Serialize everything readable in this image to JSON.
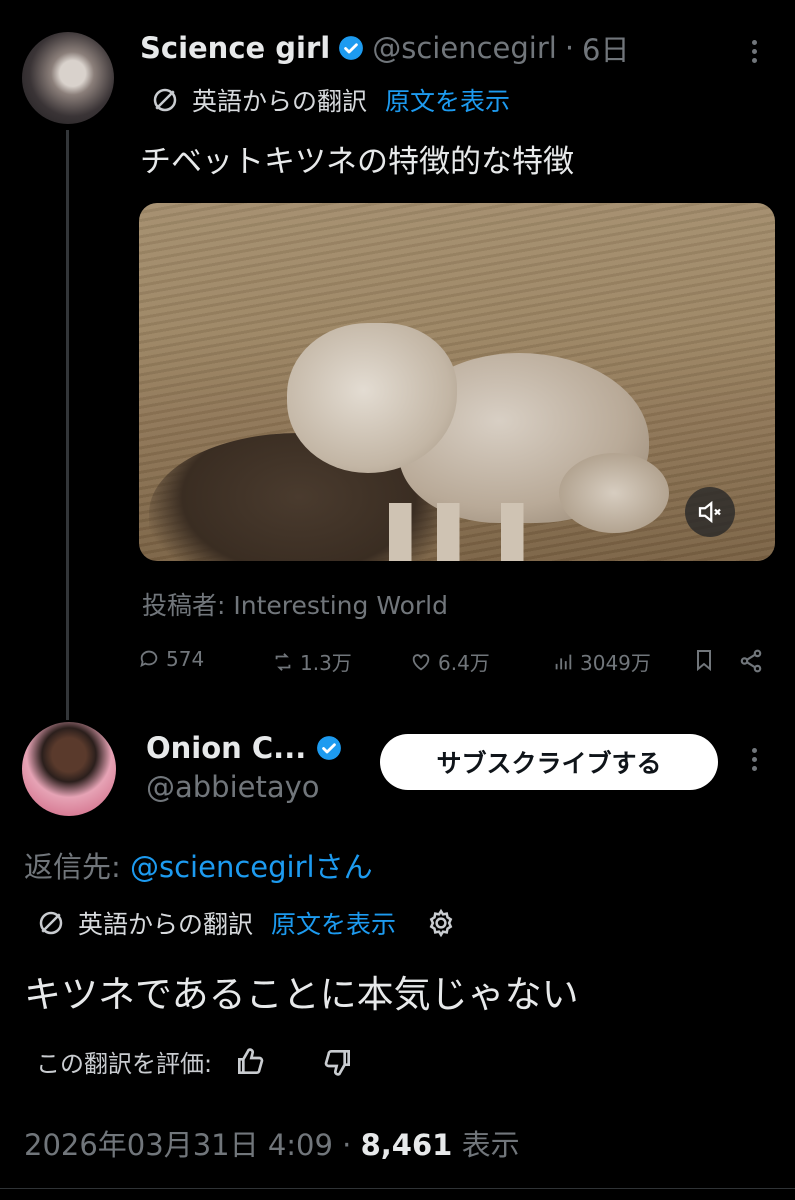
{
  "tweet": {
    "author_name": "Science girl",
    "handle": "@sciencegirl",
    "separator": "·",
    "time": "6日",
    "translated_from": "英語からの翻訳",
    "show_original": "原文を表示",
    "text": "チベットキツネの特徴的な特徴",
    "attribution": "投稿者: Interesting World",
    "actions": {
      "replies": "574",
      "retweets": "1.3万",
      "likes": "6.4万",
      "views": "3049万"
    }
  },
  "reply": {
    "author_name": "Onion C...",
    "handle": "@abbietayo",
    "subscribe_label": "サブスクライブする",
    "reply_to_prefix": "返信先: ",
    "reply_to_handle": "@sciencegirl",
    "reply_to_suffix": "さん",
    "translated_from": "英語からの翻訳",
    "show_original": "原文を表示",
    "text": "キツネであることに本気じゃない",
    "rate_translation": "この翻訳を評価:",
    "date": "2026年03月31日 4:09",
    "separator": "·",
    "views_count": "8,461",
    "views_label": "表示"
  },
  "colors": {
    "background": "#000000",
    "text": "#e7e9ea",
    "muted": "#71767b",
    "accent": "#1d9bf0"
  }
}
